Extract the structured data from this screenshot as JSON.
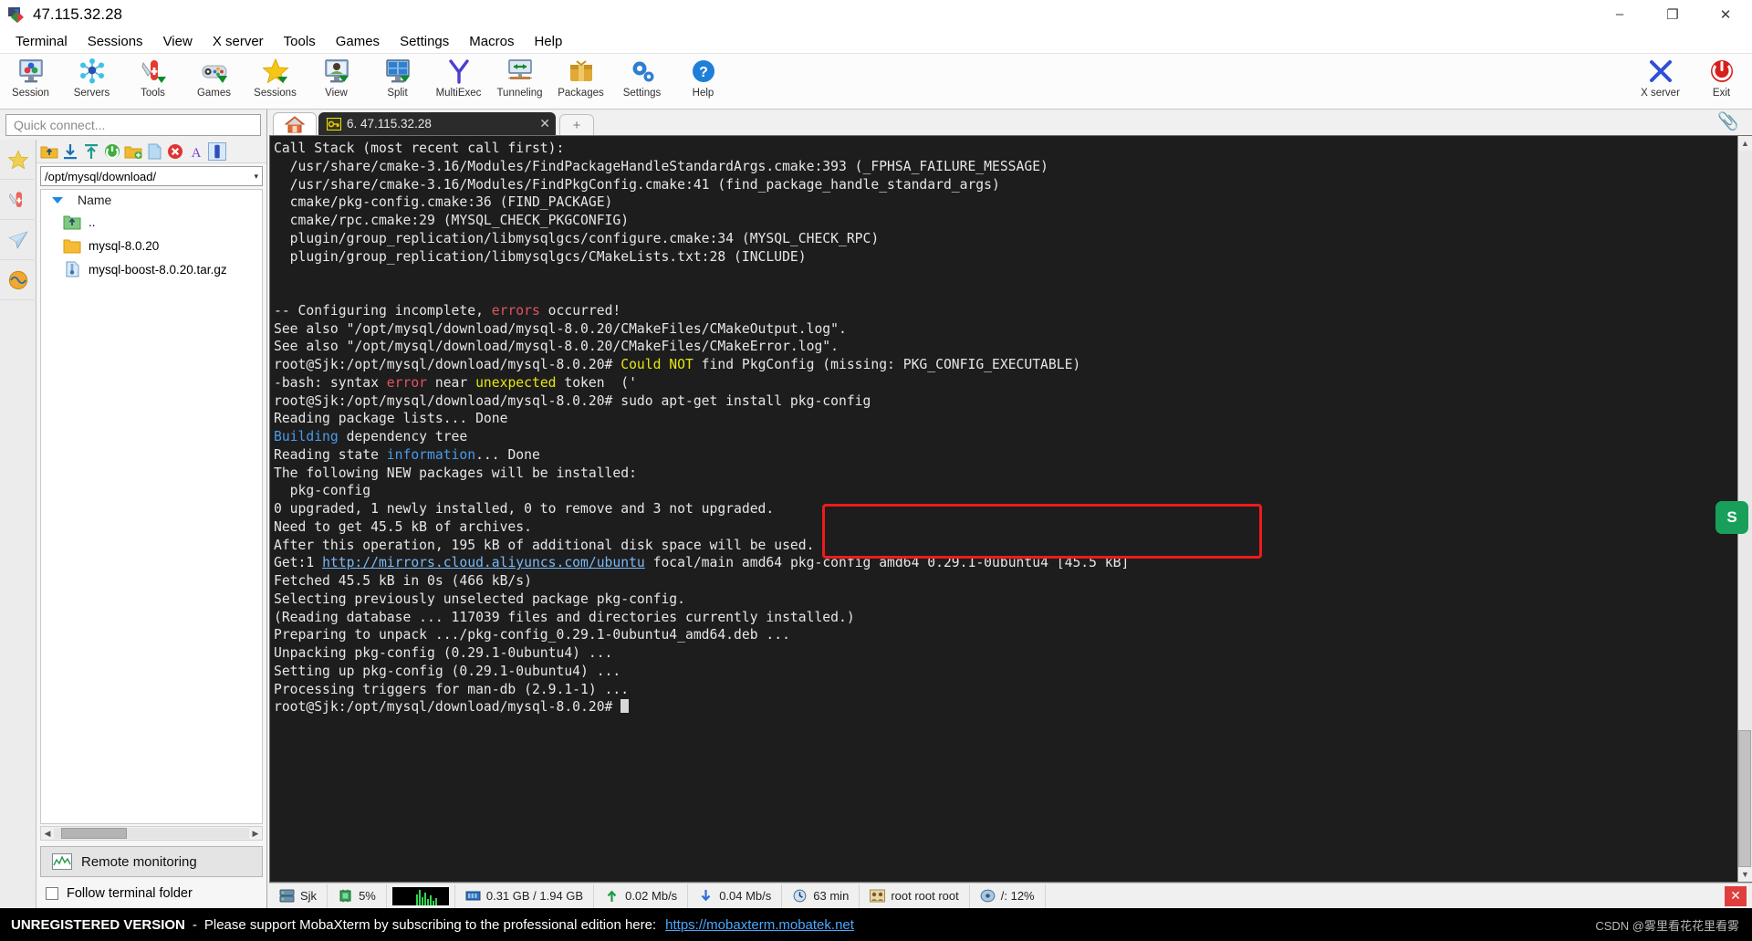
{
  "window": {
    "title": "47.115.32.28",
    "minimize": "–",
    "maximize": "❐",
    "close": "✕",
    "app_icon": "mobaxterm-icon"
  },
  "menubar": [
    {
      "label": "Terminal"
    },
    {
      "label": "Sessions"
    },
    {
      "label": "View"
    },
    {
      "label": "X server"
    },
    {
      "label": "Tools"
    },
    {
      "label": "Games"
    },
    {
      "label": "Settings"
    },
    {
      "label": "Macros"
    },
    {
      "label": "Help"
    }
  ],
  "toolbar": {
    "items": [
      {
        "label": "Session",
        "icon": "session-icon"
      },
      {
        "label": "Servers",
        "icon": "servers-icon"
      },
      {
        "label": "Tools",
        "icon": "tools-icon"
      },
      {
        "label": "Games",
        "icon": "games-icon"
      },
      {
        "label": "Sessions",
        "icon": "star-icon"
      },
      {
        "label": "View",
        "icon": "view-icon"
      },
      {
        "label": "Split",
        "icon": "split-icon"
      },
      {
        "label": "MultiExec",
        "icon": "multiexec-icon"
      },
      {
        "label": "Tunneling",
        "icon": "tunneling-icon"
      },
      {
        "label": "Packages",
        "icon": "packages-icon"
      },
      {
        "label": "Settings",
        "icon": "settings-icon"
      },
      {
        "label": "Help",
        "icon": "help-icon"
      }
    ],
    "right": [
      {
        "label": "X server",
        "icon": "xserver-icon"
      },
      {
        "label": "Exit",
        "icon": "exit-icon"
      }
    ]
  },
  "sidebar": {
    "quick_connect_placeholder": "Quick connect...",
    "tabs": [
      {
        "icon": "star-icon",
        "name": "sessions-tab"
      },
      {
        "icon": "tools-icon",
        "name": "tools-tab"
      },
      {
        "icon": "sftp-icon",
        "name": "sftp-tab"
      },
      {
        "icon": "macros-icon",
        "name": "macros-tab"
      }
    ],
    "sftp_toolbar": [
      {
        "icon": "parent-folder-icon"
      },
      {
        "icon": "download-icon"
      },
      {
        "icon": "upload-icon"
      },
      {
        "icon": "refresh-icon"
      },
      {
        "icon": "new-folder-icon"
      },
      {
        "icon": "new-file-icon"
      },
      {
        "icon": "delete-icon"
      },
      {
        "icon": "text-mode-icon"
      },
      {
        "icon": "binary-mode-icon"
      }
    ],
    "path": "/opt/mysql/download/",
    "column_header": "Name",
    "files": [
      {
        "name": "..",
        "icon": "parent-folder-icon"
      },
      {
        "name": "mysql-8.0.20",
        "icon": "folder-icon"
      },
      {
        "name": "mysql-boost-8.0.20.tar.gz",
        "icon": "archive-icon"
      }
    ],
    "remote_monitoring": "Remote monitoring",
    "follow_terminal_folder": "Follow terminal folder",
    "follow_checked": false
  },
  "tabs": {
    "home_icon": "home-icon",
    "terminal_tab": {
      "label": "6. 47.115.32.28",
      "icon": "key-icon",
      "close": "✕"
    },
    "new_tab": "+",
    "clip_icon": "paperclip-icon"
  },
  "terminal": {
    "lines": [
      [
        {
          "t": "Call Stack (most recent call first):"
        }
      ],
      [
        {
          "t": "  /usr/share/cmake-3.16/Modules/FindPackageHandleStandardArgs.cmake:393 (_FPHSA_FAILURE_MESSAGE)"
        }
      ],
      [
        {
          "t": "  /usr/share/cmake-3.16/Modules/FindPkgConfig.cmake:41 (find_package_handle_standard_args)"
        }
      ],
      [
        {
          "t": "  cmake/pkg-config.cmake:36 (FIND_PACKAGE)"
        }
      ],
      [
        {
          "t": "  cmake/rpc.cmake:29 (MYSQL_CHECK_PKGCONFIG)"
        }
      ],
      [
        {
          "t": "  plugin/group_replication/libmysqlgcs/configure.cmake:34 (MYSQL_CHECK_RPC)"
        }
      ],
      [
        {
          "t": "  plugin/group_replication/libmysqlgcs/CMakeLists.txt:28 (INCLUDE)"
        }
      ],
      [
        {
          "t": ""
        }
      ],
      [
        {
          "t": ""
        }
      ],
      [
        {
          "t": "-- Configuring incomplete, "
        },
        {
          "t": "errors",
          "c": "c-red"
        },
        {
          "t": " occurred!"
        }
      ],
      [
        {
          "t": "See also \"/opt/mysql/download/mysql-8.0.20/CMakeFiles/CMakeOutput.log\"."
        }
      ],
      [
        {
          "t": "See also \"/opt/mysql/download/mysql-8.0.20/CMakeFiles/CMakeError.log\"."
        }
      ],
      [
        {
          "t": "root@Sjk:/opt/mysql/download/mysql-8.0.20# "
        },
        {
          "t": "Could NOT",
          "c": "c-yellow"
        },
        {
          "t": " find PkgConfig (missing: PKG_CONFIG_EXECUTABLE)"
        }
      ],
      [
        {
          "t": "-bash: syntax "
        },
        {
          "t": "error",
          "c": "c-red"
        },
        {
          "t": " near "
        },
        {
          "t": "unexpected",
          "c": "c-yellow"
        },
        {
          "t": " token  ('"
        }
      ],
      [
        {
          "t": "root@Sjk:/opt/mysql/download/mysql-8.0.20# sudo apt-get install pkg-config"
        }
      ],
      [
        {
          "t": "Reading package lists... Done"
        }
      ],
      [
        {
          "t": "Building",
          "c": "c-blue"
        },
        {
          "t": " dependency tree"
        }
      ],
      [
        {
          "t": "Reading state "
        },
        {
          "t": "information",
          "c": "c-blue"
        },
        {
          "t": "... Done"
        }
      ],
      [
        {
          "t": "The following NEW packages will be installed:"
        }
      ],
      [
        {
          "t": "  pkg-config"
        }
      ],
      [
        {
          "t": "0 upgraded, 1 newly installed, 0 to remove and 3 not upgraded."
        }
      ],
      [
        {
          "t": "Need to get 45.5 kB of archives."
        }
      ],
      [
        {
          "t": "After this operation, 195 kB of additional disk space will be used."
        }
      ],
      [
        {
          "t": "Get:1 "
        },
        {
          "t": "http://mirrors.cloud.aliyuncs.com/ubuntu",
          "c": "c-link"
        },
        {
          "t": " focal/main amd64 pkg-config amd64 0.29.1-0ubuntu4 [45.5 kB]"
        }
      ],
      [
        {
          "t": "Fetched 45.5 kB in 0s (466 kB/s)"
        }
      ],
      [
        {
          "t": "Selecting previously unselected package pkg-config."
        }
      ],
      [
        {
          "t": "(Reading database ... 117039 files and directories currently installed.)"
        }
      ],
      [
        {
          "t": "Preparing to unpack .../pkg-config_0.29.1-0ubuntu4_amd64.deb ..."
        }
      ],
      [
        {
          "t": "Unpacking pkg-config (0.29.1-0ubuntu4) ..."
        }
      ],
      [
        {
          "t": "Setting up pkg-config (0.29.1-0ubuntu4) ..."
        }
      ],
      [
        {
          "t": "Processing triggers for man-db (2.9.1-1) ..."
        }
      ],
      [
        {
          "t": "root@Sjk:/opt/mysql/download/mysql-8.0.20# ",
          "cursor": true
        }
      ]
    ],
    "annotation_box_color": "#ef1a1a",
    "annotated_command": "sudo apt-get install pkg-config"
  },
  "statusbar": {
    "cells": [
      {
        "label": "Sjk",
        "icon": "server-icon"
      },
      {
        "label": "5%",
        "icon": "cpu-icon"
      },
      {
        "label": "",
        "icon": "cpu-graph"
      },
      {
        "label": "0.31 GB / 1.94 GB",
        "icon": "memory-icon"
      },
      {
        "label": "0.02 Mb/s",
        "icon": "upload-arrow-icon"
      },
      {
        "label": "0.04 Mb/s",
        "icon": "download-arrow-icon"
      },
      {
        "label": "63 min",
        "icon": "clock-icon"
      },
      {
        "label": "root root root",
        "icon": "users-icon"
      },
      {
        "label": "/: 12%",
        "icon": "disk-icon"
      }
    ],
    "close": "✕"
  },
  "banner": {
    "unregistered": "UNREGISTERED VERSION",
    "dash": "-",
    "message": "Please support MobaXterm by subscribing to the professional edition here:",
    "link": "https://mobaxterm.mobatek.net",
    "credit": "CSDN @雾里看花花里看雾"
  },
  "colors": {
    "accent_red": "#ef1a1a",
    "terminal_bg": "#1d1d1d",
    "terminal_fg": "#e6e6e6",
    "link_blue": "#4aa8ff"
  }
}
